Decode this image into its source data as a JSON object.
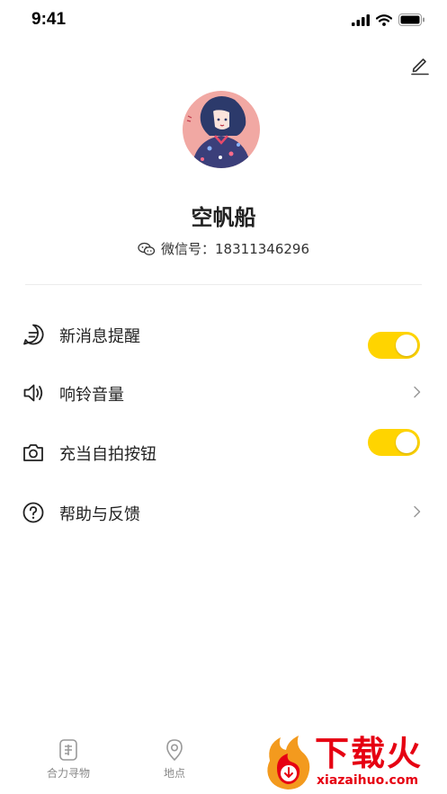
{
  "status_bar": {
    "time": "9:41"
  },
  "profile": {
    "username": "空帆船",
    "wechat_label": "微信号：",
    "wechat_id": "18311346296"
  },
  "settings": [
    {
      "label": "新消息提醒",
      "icon": "message-icon",
      "control": "toggle",
      "on": true
    },
    {
      "label": "响铃音量",
      "icon": "speaker-icon",
      "control": "chevron"
    },
    {
      "label": "充当自拍按钮",
      "icon": "camera-icon",
      "control": "toggle",
      "on": true
    },
    {
      "label": "帮助与反馈",
      "icon": "help-icon",
      "control": "chevron"
    }
  ],
  "tabbar": {
    "tabs": [
      {
        "label": "合力寻物",
        "icon": "finder-icon"
      },
      {
        "label": "地点",
        "icon": "location-pin-icon"
      }
    ]
  },
  "watermark": {
    "main": "下载火",
    "sub": "xiazaihuo.com"
  },
  "colors": {
    "accent": "#ffd400",
    "watermark": "#e60012"
  }
}
